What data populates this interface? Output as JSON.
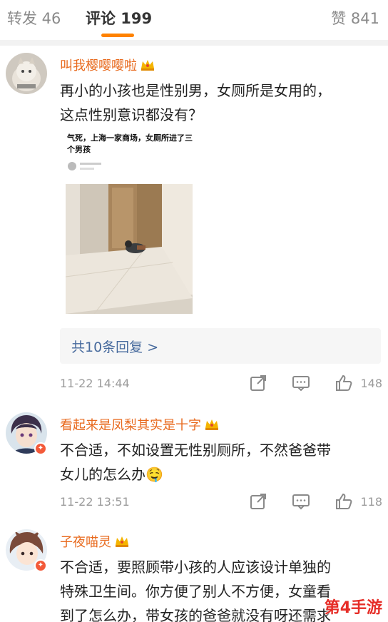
{
  "tabs": {
    "repost": "转发 46",
    "comments": "评论 199",
    "likes": "赞 841"
  },
  "comments": [
    {
      "user": "叫我樱嘤嘤啦",
      "text_lines": [
        "再小的小孩也是性别男，女厕所是女用的，",
        "这点性别意识都没有？"
      ],
      "embed": {
        "title": "气死，上海一家商场，女厕所进了三个男孩"
      },
      "replies_label": "共10条回复 >",
      "time": "11-22 14:44",
      "likes": "148"
    },
    {
      "user": "看起来是凤梨其实是十字",
      "text_lines": [
        "不合适，不如设置无性别厕所，不然爸爸带",
        "女儿的怎么办🤤"
      ],
      "time": "11-22 13:51",
      "likes": "118"
    },
    {
      "user": "子夜喵灵",
      "text_lines": [
        "不合适，要照顾带小孩的人应该设计单独的",
        "特殊卫生间。你方便了别人不方便，女童看",
        "到了怎么办，带女孩的爸爸就没有呀还需求"
      ]
    }
  ],
  "watermark": "第4手游",
  "colors": {
    "accent": "#ff8200",
    "username": "#e86a1e",
    "link": "#476a9d",
    "muted": "#9b9b9b"
  }
}
